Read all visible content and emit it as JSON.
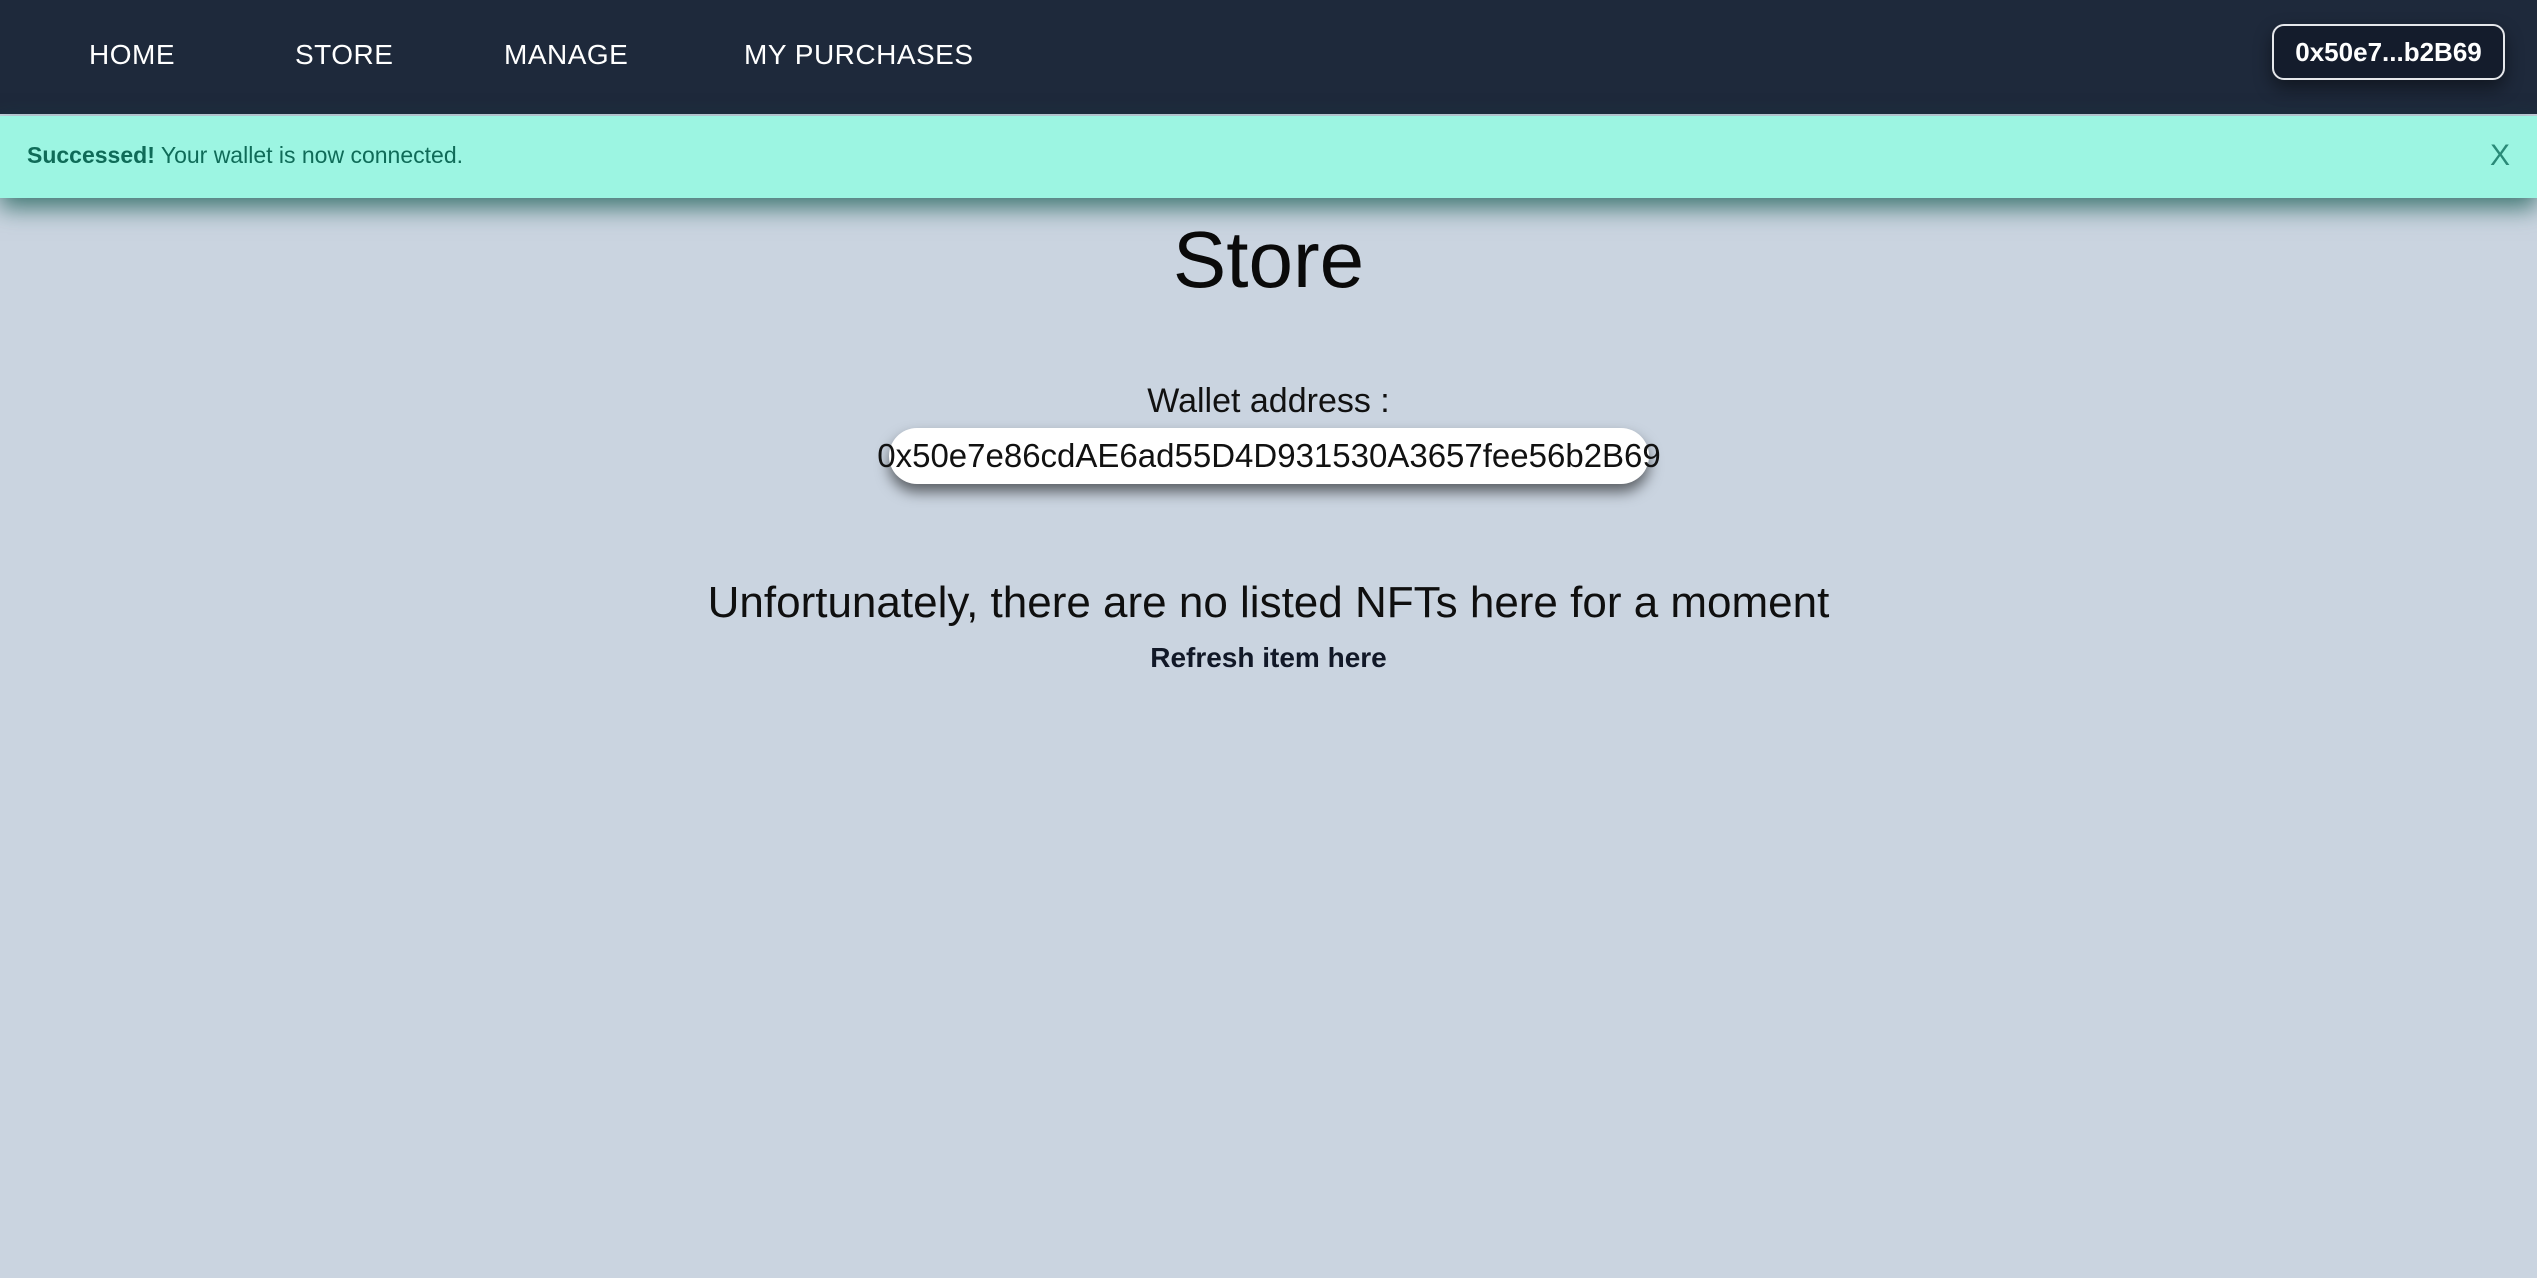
{
  "nav": {
    "items": [
      {
        "label": "HOME"
      },
      {
        "label": "STORE"
      },
      {
        "label": "MANAGE"
      },
      {
        "label": "MY PURCHASES"
      }
    ],
    "wallet_button": "0x50e7...b2B69"
  },
  "alert": {
    "strong": "Successed!",
    "message": " Your wallet is now connected.",
    "close": "X",
    "background": "#9cf5e2",
    "text_color": "#0f6b58"
  },
  "main": {
    "title": "Store",
    "wallet_label": "Wallet address :",
    "wallet_address": "0x50e7e86cdAE6ad55D4D931530A3657fee56b2B69",
    "empty_message": "Unfortunately, there are no listed NFTs here for a moment",
    "refresh_label": "Refresh item here"
  },
  "colors": {
    "navbar": "#1e293b",
    "page_background": "#cad4e0"
  }
}
